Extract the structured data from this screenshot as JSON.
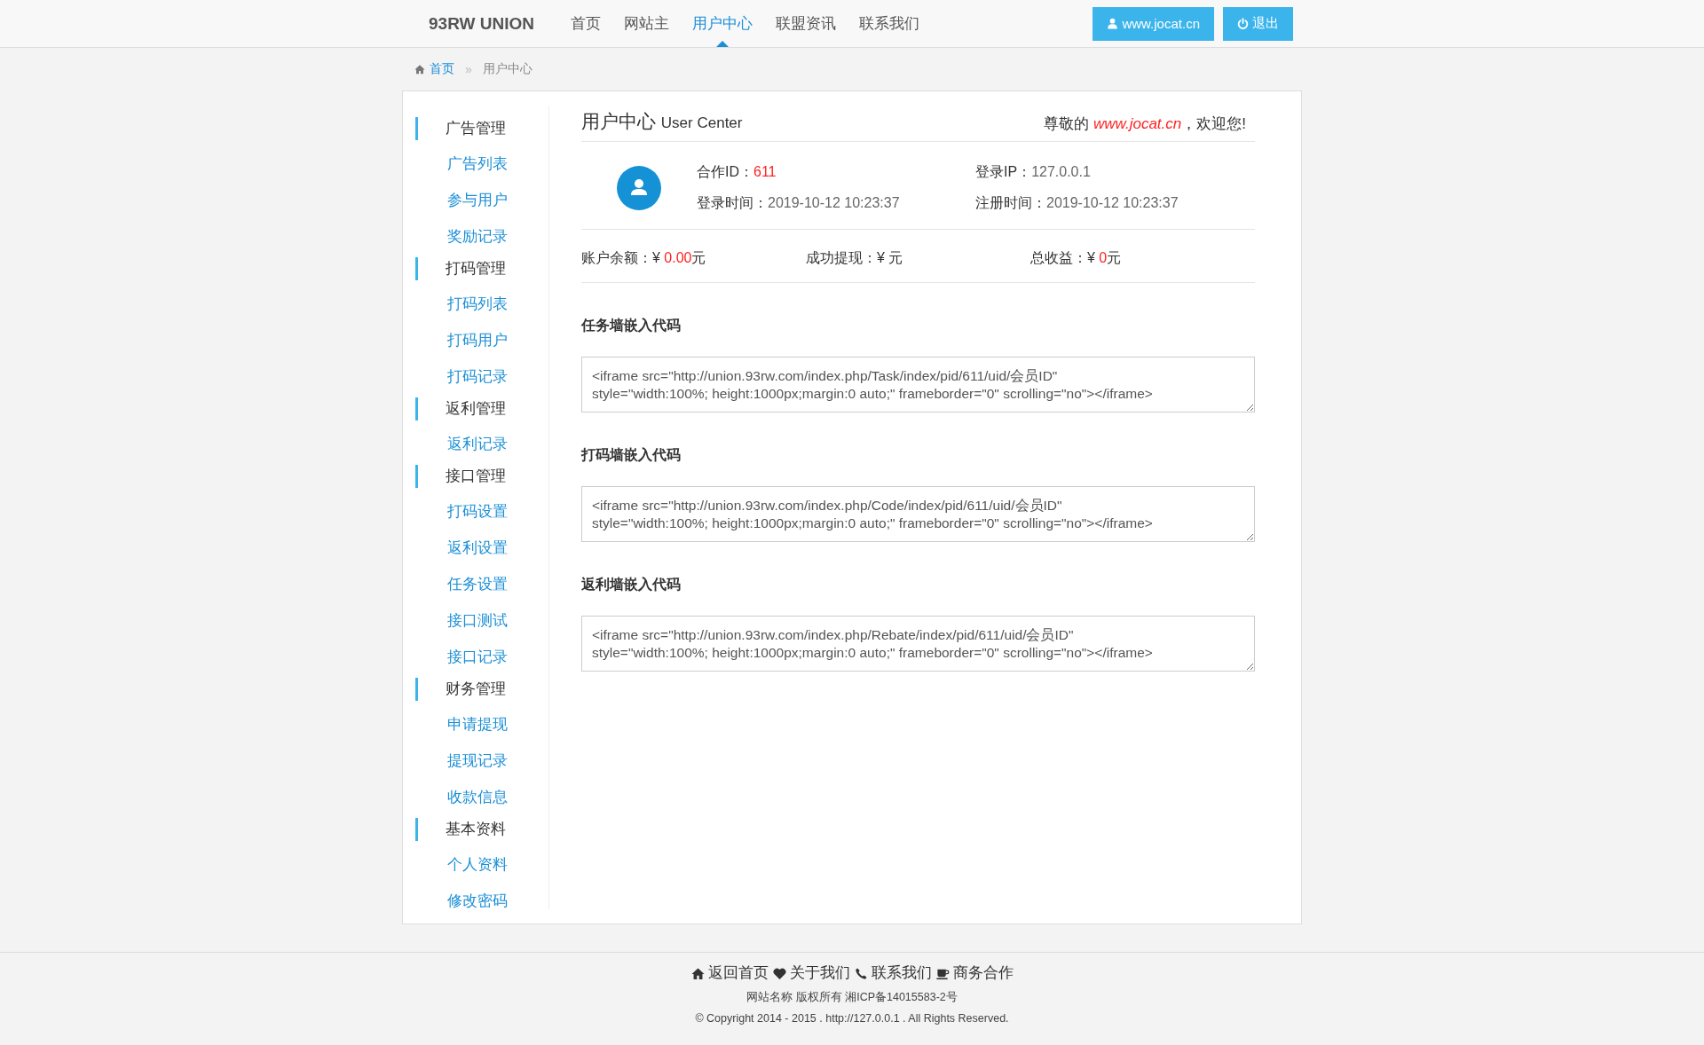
{
  "nav": {
    "brand": "93RW UNION",
    "links": [
      {
        "label": "首页",
        "selected": false
      },
      {
        "label": "网站主",
        "selected": false
      },
      {
        "label": "用户中心",
        "selected": true
      },
      {
        "label": "联盟资讯",
        "selected": false
      },
      {
        "label": "联系我们",
        "selected": false
      }
    ],
    "buttons": [
      {
        "kind": "user",
        "label": "www.jocat.cn"
      },
      {
        "kind": "power",
        "label": "退出"
      }
    ]
  },
  "breadcrumb": [
    {
      "kind": "home",
      "label": "首页"
    },
    {
      "kind": "separator",
      "label": "»"
    },
    {
      "kind": "current",
      "label": "用户中心"
    }
  ],
  "sidebar": {
    "groups": [
      {
        "title": "广告管理",
        "items": [
          "广告列表",
          "参与用户",
          "奖励记录"
        ]
      },
      {
        "title": "打码管理",
        "items": [
          "打码列表",
          "打码用户",
          "打码记录"
        ]
      },
      {
        "title": "返利管理",
        "items": [
          "返利记录"
        ]
      },
      {
        "title": "接口管理",
        "items": [
          "打码设置",
          "返利设置",
          "任务设置",
          "接口测试",
          "接口记录"
        ]
      },
      {
        "title": "财务管理",
        "items": [
          "申请提现",
          "提现记录",
          "收款信息"
        ]
      },
      {
        "title": "基本资料",
        "items": [
          "个人资料",
          "修改密码"
        ]
      }
    ]
  },
  "panel": {
    "title": "用户中心",
    "subtitle": "User Center",
    "welcome": {
      "prefix": "尊敬的 ",
      "highlight": "www.jocat.cn",
      "suffix": "，欢迎您!"
    },
    "info": [
      {
        "label": "合作ID：",
        "value": "611",
        "highlight": true
      },
      {
        "label": "登录IP：",
        "value": "127.0.0.1",
        "highlight": false
      },
      {
        "label": "登录时间：",
        "value": "2019-10-12 10:23:37",
        "highlight": false
      },
      {
        "label": "注册时间：",
        "value": "2019-10-12 10:23:37",
        "highlight": false
      }
    ],
    "balances": [
      {
        "label": "账户余额：",
        "currency": "¥",
        "amount": "0.00",
        "unit": "元"
      },
      {
        "label": "成功提现：",
        "currency": "¥",
        "unit": "元"
      },
      {
        "label": "总收益：",
        "currency": "¥",
        "amount": "0",
        "unit": "元"
      }
    ],
    "embeds": [
      {
        "title": "任务墙嵌入代码",
        "code": "<iframe src=\"http://union.93rw.com/index.php/Task/index/pid/611/uid/会员ID\"\nstyle=\"width:100%; height:1000px;margin:0 auto;\" frameborder=\"0\" scrolling=\"no\"></iframe>"
      },
      {
        "title": "打码墙嵌入代码",
        "code": "<iframe src=\"http://union.93rw.com/index.php/Code/index/pid/611/uid/会员ID\"\nstyle=\"width:100%; height:1000px;margin:0 auto;\" frameborder=\"0\" scrolling=\"no\"></iframe>"
      },
      {
        "title": "返利墙嵌入代码",
        "code": "<iframe src=\"http://union.93rw.com/index.php/Rebate/index/pid/611/uid/会员ID\"\nstyle=\"width:100%; height:1000px;margin:0 auto;\" frameborder=\"0\" scrolling=\"no\"></iframe>"
      }
    ]
  },
  "footer": {
    "links": [
      {
        "kind": "home",
        "label": "返回首页"
      },
      {
        "kind": "heart",
        "label": "关于我们"
      },
      {
        "kind": "phone",
        "label": "联系我们"
      },
      {
        "kind": "cup",
        "label": "商务合作"
      }
    ],
    "lines": [
      "网站名称 版权所有 湘ICP备14015583-2号",
      "© Copyright 2014 - 2015 . http://127.0.0.1 . All Rights Reserved."
    ]
  }
}
